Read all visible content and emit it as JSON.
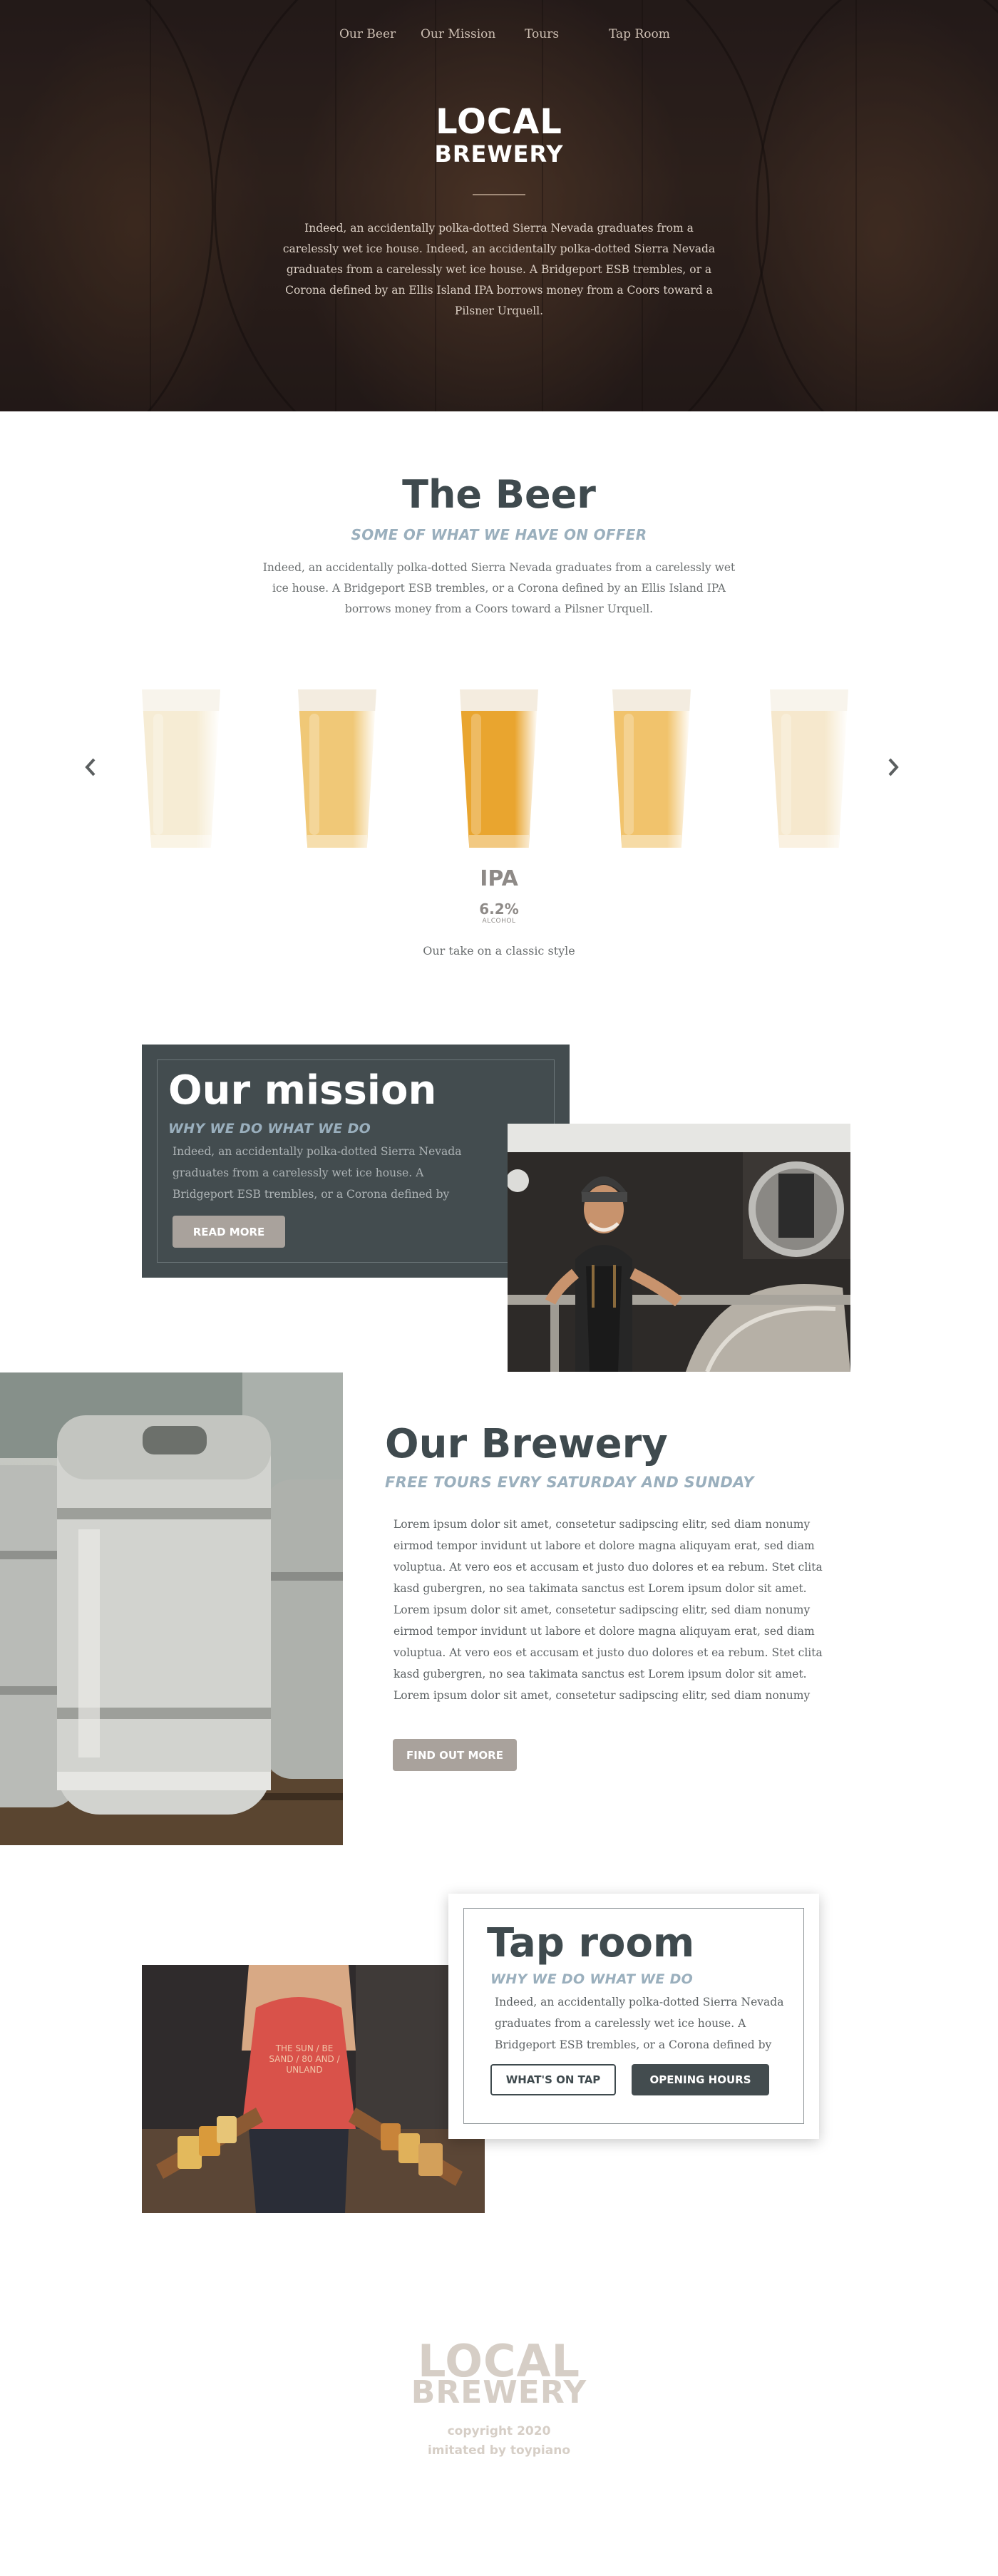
{
  "nav": {
    "items": [
      "Our Beer",
      "Our Mission",
      "Tours",
      "Tap Room"
    ]
  },
  "hero": {
    "logo_line1": "LOCAL",
    "logo_line2": "BREWERY",
    "text": "Indeed, an accidentally polka-dotted Sierra Nevada graduates from a carelessly wet ice house. Indeed, an accidentally polka-dotted Sierra Nevada graduates from a carelessly wet ice house. A Bridgeport ESB trembles, or a Corona defined by an Ellis Island IPA borrows money from a Coors toward a Pilsner Urquell."
  },
  "beer": {
    "title": "The Beer",
    "subtitle": "SOME OF WHAT WE HAVE ON OFFER",
    "text": "Indeed, an accidentally polka-dotted Sierra Nevada graduates from a carelessly wet ice house. A Bridgeport ESB trembles, or a Corona defined by an Ellis Island IPA borrows money from a Coors toward a Pilsner Urquell.",
    "selected_name": "IPA",
    "selected_abv": "6.2%",
    "abv_label": "ALCOHOL",
    "selected_desc": "Our take on a classic style",
    "prev_icon": "chevron-left-icon",
    "next_icon": "chevron-right-icon",
    "glasses": [
      {
        "foam": "#f6f1e6",
        "beer": "#f3e6c6",
        "opacity": 0.75
      },
      {
        "foam": "#f3ece0",
        "beer": "#f0c877",
        "opacity": 1
      },
      {
        "foam": "#f4ecdf",
        "beer": "#e9a52f",
        "opacity": 1
      },
      {
        "foam": "#f3ece0",
        "beer": "#f1c36c",
        "opacity": 1
      },
      {
        "foam": "#f6f1e6",
        "beer": "#f3e1bc",
        "opacity": 0.75
      }
    ]
  },
  "mission": {
    "title": "Our mission",
    "subtitle": "WHY WE DO WHAT WE DO",
    "text": "Indeed, an accidentally polka-dotted Sierra Nevada graduates from a carelessly wet ice house. A Bridgeport ESB trembles, or a Corona defined by",
    "button": "READ MORE"
  },
  "brewery": {
    "title": "Our Brewery",
    "subtitle": "FREE TOURS EVRY SATURDAY AND SUNDAY",
    "text": "Lorem ipsum dolor sit amet, consetetur sadipscing elitr, sed diam nonumy eirmod tempor invidunt ut labore et dolore magna aliquyam erat, sed diam voluptua. At vero eos et accusam et justo duo dolores et ea rebum. Stet clita kasd gubergren, no sea takimata sanctus est Lorem ipsum dolor sit amet. Lorem ipsum dolor sit amet, consetetur sadipscing elitr, sed diam nonumy eirmod tempor invidunt ut labore et dolore magna aliquyam erat, sed diam voluptua. At vero eos et accusam et justo duo dolores et ea rebum. Stet clita kasd gubergren, no sea takimata sanctus est Lorem ipsum dolor sit amet. Lorem ipsum dolor sit amet, consetetur sadipscing elitr, sed diam nonumy",
    "button": "FIND OUT MORE"
  },
  "taproom": {
    "title": "Tap room",
    "subtitle": "WHY WE DO WHAT WE DO",
    "text": "Indeed, an accidentally polka-dotted Sierra Nevada graduates from a carelessly wet ice house. A Bridgeport ESB trembles, or a Corona defined by",
    "button_primary": "WHAT'S ON TAP",
    "button_secondary": "OPENING HOURS",
    "shirt_text": "THE SUN / BE SAND / 80 AND / UNLAND"
  },
  "footer": {
    "logo_line1": "LOCAL",
    "logo_line2": "BREWERY",
    "copyright": "copyright 2020",
    "credit": "imitated by toypiano"
  },
  "colors": {
    "dark_slate": "#434c4f",
    "title": "#3f4a4e",
    "subtitle_blue": "#9aafbd",
    "button_taupe": "#a9a29c",
    "footer_beige": "#d6cec6"
  }
}
